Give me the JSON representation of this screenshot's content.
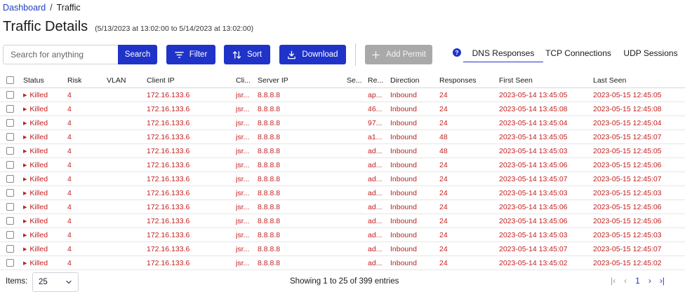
{
  "breadcrumb": {
    "home": "Dashboard",
    "separator": "/",
    "current": "Traffic"
  },
  "page": {
    "title": "Traffic Details",
    "range": "(5/13/2023 at 13:02:00 to 5/14/2023 at 13:02:00)"
  },
  "toolbar": {
    "search_placeholder": "Search for anything",
    "search_label": "Search",
    "filter_label": "Filter",
    "sort_label": "Sort",
    "download_label": "Download",
    "add_permit_label": "Add Permit",
    "help": "?"
  },
  "tabs": {
    "dns": "DNS Responses",
    "tcp": "TCP Connections",
    "udp": "UDP Sessions"
  },
  "columns": {
    "status": "Status",
    "risk": "Risk",
    "vlan": "VLAN",
    "client_ip": "Client IP",
    "cli": "Cli...",
    "server_ip": "Server IP",
    "se": "Se...",
    "re": "Re...",
    "direction": "Direction",
    "responses": "Responses",
    "first_seen": "First Seen",
    "last_seen": "Last Seen"
  },
  "rows": [
    {
      "status": "Killed",
      "risk": "4",
      "vlan": "",
      "client": "172.16.133.6",
      "cli": "jsr...",
      "server": "8.8.8.8",
      "se": "",
      "re": "ap...",
      "dir": "Inbound",
      "resp": "24",
      "first": "2023-05-14 13:45:05",
      "last": "2023-05-15 12:45:05"
    },
    {
      "status": "Killed",
      "risk": "4",
      "vlan": "",
      "client": "172.16.133.6",
      "cli": "jsr...",
      "server": "8.8.8.8",
      "se": "",
      "re": "46...",
      "dir": "Inbound",
      "resp": "24",
      "first": "2023-05-14 13:45:08",
      "last": "2023-05-15 12:45:08"
    },
    {
      "status": "Killed",
      "risk": "4",
      "vlan": "",
      "client": "172.16.133.6",
      "cli": "jsr...",
      "server": "8.8.8.8",
      "se": "",
      "re": "97...",
      "dir": "Inbound",
      "resp": "24",
      "first": "2023-05-14 13:45:04",
      "last": "2023-05-15 12:45:04"
    },
    {
      "status": "Killed",
      "risk": "4",
      "vlan": "",
      "client": "172.16.133.6",
      "cli": "jsr...",
      "server": "8.8.8.8",
      "se": "",
      "re": "a1...",
      "dir": "Inbound",
      "resp": "48",
      "first": "2023-05-14 13:45:05",
      "last": "2023-05-15 12:45:07"
    },
    {
      "status": "Killed",
      "risk": "4",
      "vlan": "",
      "client": "172.16.133.6",
      "cli": "jsr...",
      "server": "8.8.8.8",
      "se": "",
      "re": "ad...",
      "dir": "Inbound",
      "resp": "48",
      "first": "2023-05-14 13:45:03",
      "last": "2023-05-15 12:45:05"
    },
    {
      "status": "Killed",
      "risk": "4",
      "vlan": "",
      "client": "172.16.133.6",
      "cli": "jsr...",
      "server": "8.8.8.8",
      "se": "",
      "re": "ad...",
      "dir": "Inbound",
      "resp": "24",
      "first": "2023-05-14 13:45:06",
      "last": "2023-05-15 12:45:06"
    },
    {
      "status": "Killed",
      "risk": "4",
      "vlan": "",
      "client": "172.16.133.6",
      "cli": "jsr...",
      "server": "8.8.8.8",
      "se": "",
      "re": "ad...",
      "dir": "Inbound",
      "resp": "24",
      "first": "2023-05-14 13:45:07",
      "last": "2023-05-15 12:45:07"
    },
    {
      "status": "Killed",
      "risk": "4",
      "vlan": "",
      "client": "172.16.133.6",
      "cli": "jsr...",
      "server": "8.8.8.8",
      "se": "",
      "re": "ad...",
      "dir": "Inbound",
      "resp": "24",
      "first": "2023-05-14 13:45:03",
      "last": "2023-05-15 12:45:03"
    },
    {
      "status": "Killed",
      "risk": "4",
      "vlan": "",
      "client": "172.16.133.6",
      "cli": "jsr...",
      "server": "8.8.8.8",
      "se": "",
      "re": "ad...",
      "dir": "Inbound",
      "resp": "24",
      "first": "2023-05-14 13:45:06",
      "last": "2023-05-15 12:45:06"
    },
    {
      "status": "Killed",
      "risk": "4",
      "vlan": "",
      "client": "172.16.133.6",
      "cli": "jsr...",
      "server": "8.8.8.8",
      "se": "",
      "re": "ad...",
      "dir": "Inbound",
      "resp": "24",
      "first": "2023-05-14 13:45:06",
      "last": "2023-05-15 12:45:06"
    },
    {
      "status": "Killed",
      "risk": "4",
      "vlan": "",
      "client": "172.16.133.6",
      "cli": "jsr...",
      "server": "8.8.8.8",
      "se": "",
      "re": "ad...",
      "dir": "Inbound",
      "resp": "24",
      "first": "2023-05-14 13:45:03",
      "last": "2023-05-15 12:45:03"
    },
    {
      "status": "Killed",
      "risk": "4",
      "vlan": "",
      "client": "172.16.133.6",
      "cli": "jsr...",
      "server": "8.8.8.8",
      "se": "",
      "re": "ad...",
      "dir": "Inbound",
      "resp": "24",
      "first": "2023-05-14 13:45:07",
      "last": "2023-05-15 12:45:07"
    },
    {
      "status": "Killed",
      "risk": "4",
      "vlan": "",
      "client": "172.16.133.6",
      "cli": "jsr...",
      "server": "8.8.8.8",
      "se": "",
      "re": "ad...",
      "dir": "Inbound",
      "resp": "24",
      "first": "2023-05-14 13:45:02",
      "last": "2023-05-15 12:45:02"
    }
  ],
  "footer": {
    "items_label": "Items:",
    "items_value": "25",
    "showing": "Showing 1 to 25 of 399 entries",
    "current_page": "1"
  },
  "colors": {
    "accent": "#1f33c9",
    "killed": "#c12020",
    "disabled": "#a9a9a9"
  }
}
